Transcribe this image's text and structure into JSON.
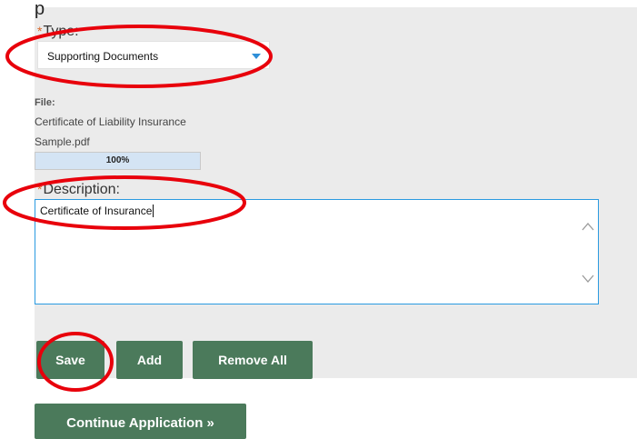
{
  "top_cropped_text": "p",
  "type_field": {
    "required_marker": "*",
    "label": "Type:",
    "selected_value": "Supporting Documents"
  },
  "file": {
    "label": "File:",
    "name": "Certificate of Liability Insurance Sample.pdf",
    "progress_text": "100%",
    "progress_fraction": 1.0
  },
  "description_field": {
    "required_marker": "*",
    "label": "Description:",
    "value": "Certificate of Insurance"
  },
  "buttons": {
    "save": "Save",
    "add": "Add",
    "remove_all": "Remove All",
    "continue": "Continue Application »"
  },
  "colors": {
    "panel_bg": "#ebebeb",
    "button_green": "#4b7a5b",
    "required_orange": "#d9682a",
    "focus_blue": "#2a9ae0",
    "annotation_red": "#e8000b",
    "progress_fill": "#d4e4f4"
  },
  "icons": {
    "select_arrow": "caret-down-icon",
    "scroll_up": "chevron-up-icon",
    "scroll_down": "chevron-down-icon"
  }
}
